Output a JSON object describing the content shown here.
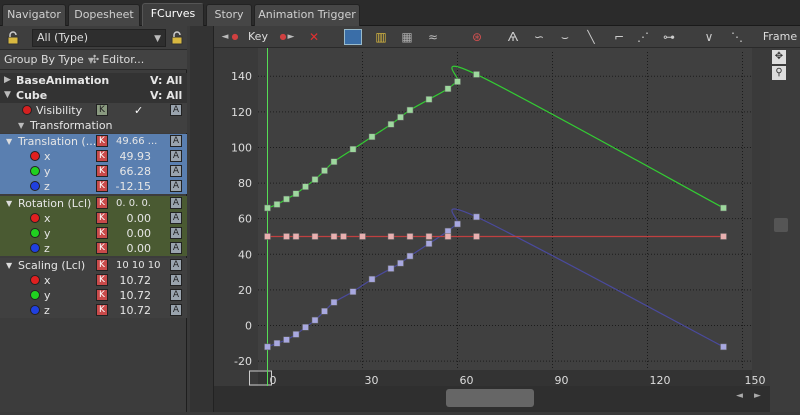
{
  "tabs": [
    {
      "label": "Navigator",
      "active": false
    },
    {
      "label": "Dopesheet",
      "active": false
    },
    {
      "label": "FCurves",
      "active": true
    },
    {
      "label": "Story",
      "active": false
    },
    {
      "label": "Animation Trigger",
      "active": false
    }
  ],
  "left_panel": {
    "type_select": "All (Type)",
    "group_by": "Group By Type",
    "editor": "Editor...",
    "tree": [
      {
        "label": "BaseAnimation",
        "extra": "V: All"
      },
      {
        "label": "Cube",
        "extra": "V: All"
      },
      {
        "label": "Visibility",
        "k": "K",
        "check": "✓",
        "a": "A"
      },
      {
        "label": "Transformation"
      },
      {
        "label": "Translation (...",
        "values": "49.66  ...",
        "k": "K",
        "a": "A"
      },
      {
        "label": "x",
        "value": "49.93",
        "k": "K",
        "a": "A"
      },
      {
        "label": "y",
        "value": "66.28",
        "k": "K",
        "a": "A"
      },
      {
        "label": "z",
        "value": "-12.15",
        "k": "K",
        "a": "A"
      },
      {
        "label": "Rotation (Lcl)",
        "values": "0.  0.  0.",
        "k": "K",
        "a": "A"
      },
      {
        "label": "x",
        "value": "0.00",
        "k": "K",
        "a": "A"
      },
      {
        "label": "y",
        "value": "0.00",
        "k": "K",
        "a": "A"
      },
      {
        "label": "z",
        "value": "0.00",
        "k": "K",
        "a": "A"
      },
      {
        "label": "Scaling (Lcl)",
        "values": "10 10 10",
        "k": "K",
        "a": "A"
      },
      {
        "label": "x",
        "value": "10.72",
        "k": "K",
        "a": "A"
      },
      {
        "label": "y",
        "value": "10.72",
        "k": "K",
        "a": "A"
      },
      {
        "label": "z",
        "value": "10.72",
        "k": "K",
        "a": "A"
      }
    ]
  },
  "toolbar": {
    "key_label": "Key",
    "frame_label": "Frame"
  },
  "chart_data": {
    "type": "line",
    "xticks": [
      "0",
      "30",
      "60",
      "90",
      "120",
      "150"
    ],
    "yticks": [
      "140",
      "120",
      "100",
      "80",
      "60",
      "40",
      "20",
      "0",
      "-20"
    ],
    "xlim": [
      -3,
      153
    ],
    "ylim": [
      -25,
      148
    ],
    "current_frame": 0,
    "series": [
      {
        "color": "#33cc33",
        "keys": [
          [
            0,
            66
          ],
          [
            3,
            68
          ],
          [
            6,
            71
          ],
          [
            9,
            74
          ],
          [
            12,
            78
          ],
          [
            15,
            82
          ],
          [
            18,
            87
          ],
          [
            21,
            92
          ],
          [
            27,
            99
          ],
          [
            33,
            106
          ],
          [
            39,
            113
          ],
          [
            42,
            117
          ],
          [
            45,
            121
          ],
          [
            51,
            127
          ],
          [
            57,
            133
          ],
          [
            60,
            137
          ],
          [
            66,
            141
          ],
          [
            144,
            66
          ]
        ]
      },
      {
        "color": "#4a4a9e",
        "keys": [
          [
            0,
            -12
          ],
          [
            3,
            -10
          ],
          [
            6,
            -8
          ],
          [
            9,
            -5
          ],
          [
            12,
            -1
          ],
          [
            15,
            3
          ],
          [
            18,
            8
          ],
          [
            21,
            13
          ],
          [
            27,
            19
          ],
          [
            33,
            26
          ],
          [
            39,
            32
          ],
          [
            42,
            35
          ],
          [
            45,
            39
          ],
          [
            51,
            46
          ],
          [
            57,
            53
          ],
          [
            60,
            57
          ],
          [
            66,
            61
          ],
          [
            144,
            -12
          ]
        ]
      },
      {
        "color": "#c04040",
        "keys": [
          [
            0,
            50
          ],
          [
            6,
            50
          ],
          [
            9,
            50
          ],
          [
            15,
            50
          ],
          [
            21,
            50
          ],
          [
            24,
            50
          ],
          [
            30,
            50
          ],
          [
            39,
            50
          ],
          [
            45,
            50
          ],
          [
            51,
            50
          ],
          [
            57,
            50
          ],
          [
            66,
            50
          ],
          [
            144,
            50
          ]
        ]
      }
    ]
  }
}
